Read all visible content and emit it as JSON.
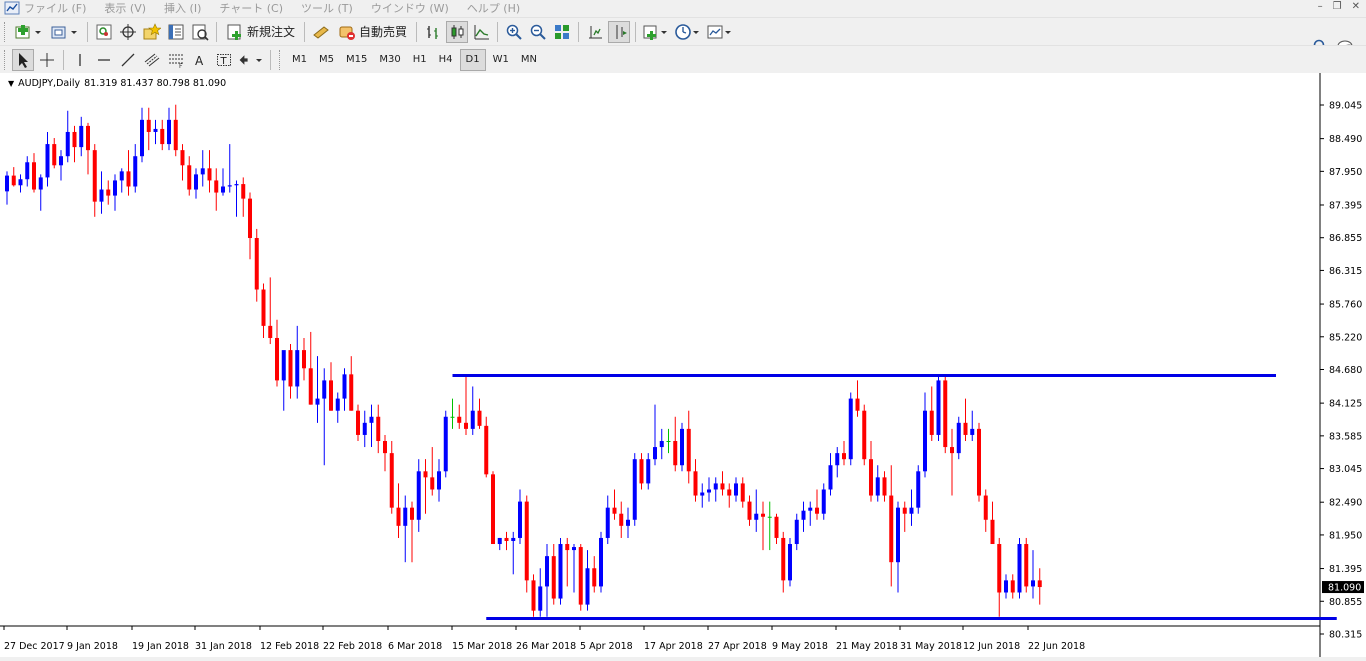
{
  "menu": [
    "ファイル (F)",
    "表示 (V)",
    "挿入 (I)",
    "チャート (C)",
    "ツール (T)",
    "ウインドウ (W)",
    "ヘルプ (H)"
  ],
  "toolbar": {
    "new_order_label": "新規注文",
    "auto_trade_label": "自動売買"
  },
  "timeframes": [
    "M1",
    "M5",
    "M15",
    "M30",
    "H1",
    "H4",
    "D1",
    "W1",
    "MN"
  ],
  "active_timeframe": "D1",
  "chart": {
    "symbol": "AUDJPY,Daily",
    "ohlc": "81.319 81.437 80.798 81.090",
    "current_price_label": "81.090"
  },
  "colors": {
    "bull": "#0000ff",
    "bear": "#ff0000",
    "trendline": "#0000e6",
    "neutral": "#00c000"
  },
  "chart_data": {
    "type": "candlestick",
    "y_ticks": [
      "89.045",
      "88.490",
      "87.950",
      "87.395",
      "86.855",
      "86.315",
      "85.760",
      "85.220",
      "84.680",
      "84.125",
      "83.585",
      "83.045",
      "82.490",
      "81.950",
      "81.395",
      "80.855",
      "80.315"
    ],
    "ylim": [
      80.315,
      89.045
    ],
    "x_ticks": [
      "27 Dec 2017",
      "9 Jan 2018",
      "19 Jan 2018",
      "31 Jan 2018",
      "12 Feb 2018",
      "22 Feb 2018",
      "6 Mar 2018",
      "15 Mar 2018",
      "26 Mar 2018",
      "5 Apr 2018",
      "17 Apr 2018",
      "27 Apr 2018",
      "9 May 2018",
      "21 May 2018",
      "31 May 2018",
      "12 Jun 2018",
      "22 Jun 2018"
    ],
    "horizontal_lines": [
      {
        "name": "resistance",
        "price": 84.58,
        "from_bar": 66,
        "to_bar": 188
      },
      {
        "name": "support",
        "price": 80.57,
        "from_bar": 71,
        "to_bar": 197
      }
    ],
    "candles": [
      [
        87.62,
        87.95,
        87.4,
        87.88
      ],
      [
        87.88,
        88.02,
        87.7,
        87.72
      ],
      [
        87.72,
        87.9,
        87.6,
        87.82
      ],
      [
        87.82,
        88.2,
        87.7,
        88.1
      ],
      [
        88.1,
        88.25,
        87.6,
        87.65
      ],
      [
        87.65,
        87.9,
        87.3,
        87.85
      ],
      [
        87.85,
        88.6,
        87.7,
        88.4
      ],
      [
        88.4,
        88.5,
        88.0,
        88.05
      ],
      [
        88.05,
        88.3,
        87.8,
        88.2
      ],
      [
        88.2,
        88.95,
        88.1,
        88.6
      ],
      [
        88.6,
        88.7,
        88.1,
        88.35
      ],
      [
        88.35,
        88.85,
        88.2,
        88.7
      ],
      [
        88.7,
        88.75,
        87.9,
        88.3
      ],
      [
        88.3,
        88.4,
        87.2,
        87.45
      ],
      [
        87.45,
        87.95,
        87.25,
        87.65
      ],
      [
        87.65,
        87.8,
        87.4,
        87.55
      ],
      [
        87.55,
        87.9,
        87.3,
        87.8
      ],
      [
        87.8,
        88.0,
        87.6,
        87.95
      ],
      [
        87.95,
        88.3,
        87.55,
        87.7
      ],
      [
        87.7,
        88.4,
        87.6,
        88.2
      ],
      [
        88.2,
        89.0,
        88.1,
        88.8
      ],
      [
        88.8,
        89.0,
        88.3,
        88.6
      ],
      [
        88.6,
        88.8,
        88.4,
        88.65
      ],
      [
        88.65,
        88.8,
        88.3,
        88.4
      ],
      [
        88.4,
        89.0,
        88.3,
        88.8
      ],
      [
        88.8,
        89.05,
        88.2,
        88.3
      ],
      [
        88.3,
        88.4,
        87.8,
        88.05
      ],
      [
        88.05,
        88.2,
        87.55,
        87.65
      ],
      [
        87.65,
        88.0,
        87.5,
        87.9
      ],
      [
        87.9,
        88.3,
        87.7,
        88.0
      ],
      [
        88.0,
        88.3,
        87.6,
        87.8
      ],
      [
        87.8,
        88.0,
        87.3,
        87.6
      ],
      [
        87.6,
        88.0,
        87.55,
        87.7
      ],
      [
        87.7,
        88.4,
        87.6,
        87.72
      ],
      [
        87.72,
        87.8,
        87.2,
        87.74
      ],
      [
        87.74,
        87.85,
        87.2,
        87.5
      ],
      [
        87.5,
        87.6,
        86.5,
        86.85
      ],
      [
        86.85,
        87.0,
        85.8,
        86.0
      ],
      [
        86.0,
        86.1,
        85.2,
        85.4
      ],
      [
        85.4,
        86.2,
        85.1,
        85.2
      ],
      [
        85.2,
        85.5,
        84.4,
        84.5
      ],
      [
        84.5,
        84.9,
        84.0,
        85.0
      ],
      [
        85.0,
        85.1,
        84.2,
        84.4
      ],
      [
        84.4,
        85.4,
        84.2,
        85.0
      ],
      [
        85.0,
        85.2,
        84.5,
        84.7
      ],
      [
        84.7,
        85.3,
        84.1,
        84.1
      ],
      [
        84.1,
        84.9,
        83.8,
        84.2
      ],
      [
        84.2,
        84.7,
        83.1,
        84.5
      ],
      [
        84.5,
        84.8,
        84.0,
        84.0
      ],
      [
        84.0,
        84.3,
        83.8,
        84.2
      ],
      [
        84.2,
        84.7,
        84.0,
        84.6
      ],
      [
        84.6,
        84.9,
        84.0,
        84.0
      ],
      [
        84.0,
        84.1,
        83.5,
        83.6
      ],
      [
        83.6,
        84.0,
        83.4,
        83.8
      ],
      [
        83.8,
        84.1,
        83.4,
        83.9
      ],
      [
        83.9,
        84.1,
        83.3,
        83.5
      ],
      [
        83.5,
        83.6,
        83.0,
        83.3
      ],
      [
        83.3,
        83.5,
        82.3,
        82.4
      ],
      [
        82.4,
        82.8,
        81.9,
        82.1
      ],
      [
        82.1,
        82.6,
        81.5,
        82.4
      ],
      [
        82.4,
        82.5,
        81.5,
        82.2
      ],
      [
        82.2,
        83.2,
        82.0,
        83.0
      ],
      [
        83.0,
        83.2,
        82.3,
        82.9
      ],
      [
        82.9,
        83.4,
        82.6,
        82.7
      ],
      [
        82.7,
        83.2,
        82.5,
        83.0
      ],
      [
        83.0,
        84.0,
        82.9,
        83.9
      ],
      [
        83.9,
        84.2,
        83.7,
        83.9
      ],
      [
        83.9,
        84.1,
        83.7,
        83.8
      ],
      [
        83.8,
        84.6,
        83.6,
        83.7
      ],
      [
        83.7,
        84.4,
        83.6,
        84.0
      ],
      [
        84.0,
        84.2,
        83.7,
        83.75
      ],
      [
        83.75,
        83.9,
        82.9,
        82.95
      ],
      [
        82.95,
        83.0,
        81.8,
        81.8
      ],
      [
        81.8,
        81.9,
        81.7,
        81.9
      ],
      [
        81.9,
        82.0,
        81.7,
        81.85
      ],
      [
        81.85,
        82.0,
        81.3,
        81.9
      ],
      [
        81.9,
        82.7,
        81.8,
        82.5
      ],
      [
        82.5,
        82.6,
        81.0,
        81.2
      ],
      [
        81.2,
        81.3,
        80.6,
        80.7
      ],
      [
        80.7,
        81.4,
        80.6,
        81.1
      ],
      [
        81.1,
        81.8,
        80.6,
        81.6
      ],
      [
        81.6,
        81.8,
        80.8,
        80.9
      ],
      [
        80.9,
        81.9,
        80.8,
        81.8
      ],
      [
        81.8,
        81.9,
        81.1,
        81.7
      ],
      [
        81.7,
        81.8,
        81.0,
        81.75
      ],
      [
        81.75,
        81.8,
        80.7,
        80.8
      ],
      [
        80.8,
        81.7,
        80.7,
        81.4
      ],
      [
        81.4,
        81.6,
        81.0,
        81.1
      ],
      [
        81.1,
        82.0,
        81.0,
        81.9
      ],
      [
        81.9,
        82.6,
        81.8,
        82.4
      ],
      [
        82.4,
        82.7,
        82.2,
        82.3
      ],
      [
        82.3,
        82.5,
        81.9,
        82.1
      ],
      [
        82.1,
        82.4,
        81.9,
        82.2
      ],
      [
        82.2,
        83.3,
        82.1,
        83.2
      ],
      [
        83.2,
        83.3,
        82.7,
        82.8
      ],
      [
        82.8,
        83.3,
        82.7,
        83.2
      ],
      [
        83.2,
        84.1,
        83.1,
        83.4
      ],
      [
        83.4,
        83.7,
        83.2,
        83.5
      ],
      [
        83.5,
        83.7,
        83.3,
        83.5
      ],
      [
        83.5,
        83.9,
        83.0,
        83.1
      ],
      [
        83.1,
        83.8,
        83.0,
        83.7
      ],
      [
        83.7,
        84.0,
        82.8,
        83.0
      ],
      [
        83.0,
        83.2,
        82.5,
        82.6
      ],
      [
        82.6,
        82.8,
        82.4,
        82.65
      ],
      [
        82.65,
        82.9,
        82.5,
        82.7
      ],
      [
        82.7,
        82.9,
        82.5,
        82.8
      ],
      [
        82.8,
        83.0,
        82.6,
        82.7
      ],
      [
        82.7,
        82.8,
        82.4,
        82.6
      ],
      [
        82.6,
        82.9,
        82.5,
        82.8
      ],
      [
        82.8,
        82.9,
        82.4,
        82.5
      ],
      [
        82.5,
        82.6,
        82.1,
        82.2
      ],
      [
        82.2,
        82.7,
        82.0,
        82.3
      ],
      [
        82.3,
        82.5,
        81.7,
        82.25
      ],
      [
        82.25,
        82.5,
        81.7,
        82.25
      ],
      [
        82.25,
        82.3,
        81.8,
        81.9
      ],
      [
        81.9,
        82.0,
        81.0,
        81.2
      ],
      [
        81.2,
        81.9,
        81.1,
        81.8
      ],
      [
        81.8,
        82.3,
        81.7,
        82.2
      ],
      [
        82.2,
        82.5,
        82.0,
        82.35
      ],
      [
        82.35,
        82.5,
        82.1,
        82.4
      ],
      [
        82.4,
        82.7,
        82.2,
        82.3
      ],
      [
        82.3,
        82.8,
        82.2,
        82.7
      ],
      [
        82.7,
        83.3,
        82.6,
        83.1
      ],
      [
        83.1,
        83.4,
        82.9,
        83.3
      ],
      [
        83.3,
        83.5,
        83.1,
        83.2
      ],
      [
        83.2,
        84.3,
        83.1,
        84.2
      ],
      [
        84.2,
        84.5,
        83.9,
        84.0
      ],
      [
        84.0,
        84.1,
        83.1,
        83.2
      ],
      [
        83.2,
        83.5,
        82.5,
        82.6
      ],
      [
        82.6,
        83.1,
        82.5,
        82.9
      ],
      [
        82.9,
        83.0,
        82.5,
        82.6
      ],
      [
        82.6,
        83.1,
        81.1,
        81.5
      ],
      [
        81.5,
        82.5,
        81.0,
        82.4
      ],
      [
        82.4,
        82.5,
        82.0,
        82.3
      ],
      [
        82.3,
        82.7,
        82.1,
        82.4
      ],
      [
        82.4,
        83.1,
        82.3,
        83.0
      ],
      [
        83.0,
        84.3,
        82.9,
        84.0
      ],
      [
        84.0,
        84.4,
        83.5,
        83.6
      ],
      [
        83.6,
        84.6,
        83.5,
        84.5
      ],
      [
        84.5,
        84.6,
        83.3,
        83.4
      ],
      [
        83.4,
        83.7,
        82.6,
        83.3
      ],
      [
        83.3,
        83.9,
        83.2,
        83.8
      ],
      [
        83.8,
        84.2,
        83.5,
        83.6
      ],
      [
        83.6,
        84.0,
        83.5,
        83.7
      ],
      [
        83.7,
        83.8,
        82.5,
        82.6
      ],
      [
        82.6,
        82.7,
        82.0,
        82.2
      ],
      [
        82.2,
        82.5,
        81.8,
        81.8
      ],
      [
        81.8,
        81.9,
        80.6,
        81.0
      ],
      [
        81.0,
        81.3,
        80.9,
        81.2
      ],
      [
        81.2,
        81.3,
        80.9,
        81.0
      ],
      [
        81.0,
        81.9,
        80.9,
        81.8
      ],
      [
        81.8,
        81.9,
        81.0,
        81.1
      ],
      [
        81.1,
        81.7,
        80.9,
        81.2
      ],
      [
        81.2,
        81.4,
        80.8,
        81.09
      ]
    ]
  }
}
